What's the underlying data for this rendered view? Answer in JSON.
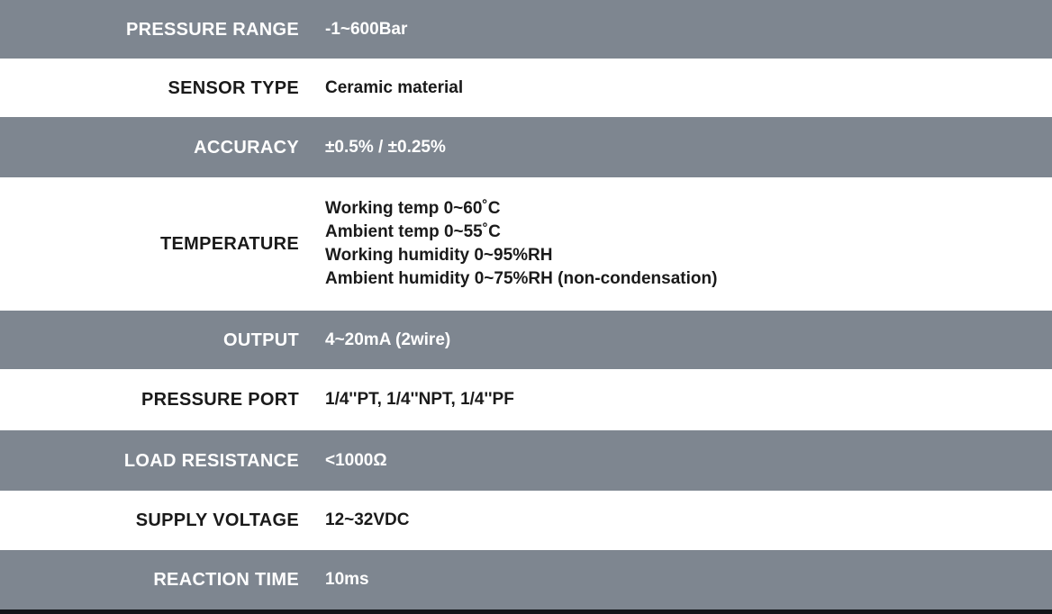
{
  "table": {
    "colors": {
      "stripe_gray": "#7e8690",
      "stripe_white": "#ffffff",
      "gray_text": "#ffffff",
      "white_text": "#1a1a1a",
      "bottom_strip": "#111418"
    },
    "rows": [
      {
        "label": "PRESSURE RANGE",
        "value": "-1~600Bar",
        "stripe": "gray",
        "height": "row-h65"
      },
      {
        "label": "SENSOR TYPE",
        "value": "Ceramic material",
        "stripe": "white",
        "height": "row-h65"
      },
      {
        "label": "ACCURACY",
        "value": "±0.5% / ±0.25%",
        "stripe": "gray",
        "height": "row-h67"
      },
      {
        "label": "TEMPERATURE",
        "value": "Working temp 0~60˚C\nAmbient temp 0~55˚C\nWorking humidity 0~95%RH\nAmbient humidity 0~75%RH (non-condensation)",
        "stripe": "white",
        "height": "row-h148"
      },
      {
        "label": "OUTPUT",
        "value": "4~20mA (2wire)",
        "stripe": "gray",
        "height": "row-h65"
      },
      {
        "label": "PRESSURE PORT",
        "value": "1/4''PT, 1/4''NPT, 1/4''PF",
        "stripe": "white",
        "height": "row-h68"
      },
      {
        "label": "LOAD RESISTANCE",
        "value": "<1000Ω",
        "stripe": "gray",
        "height": "row-h67"
      },
      {
        "label": "SUPPLY VOLTAGE",
        "value": "12~32VDC",
        "stripe": "white",
        "height": "row-h66"
      },
      {
        "label": "REACTION TIME",
        "value": "10ms",
        "stripe": "gray",
        "height": "row-h66"
      }
    ]
  }
}
